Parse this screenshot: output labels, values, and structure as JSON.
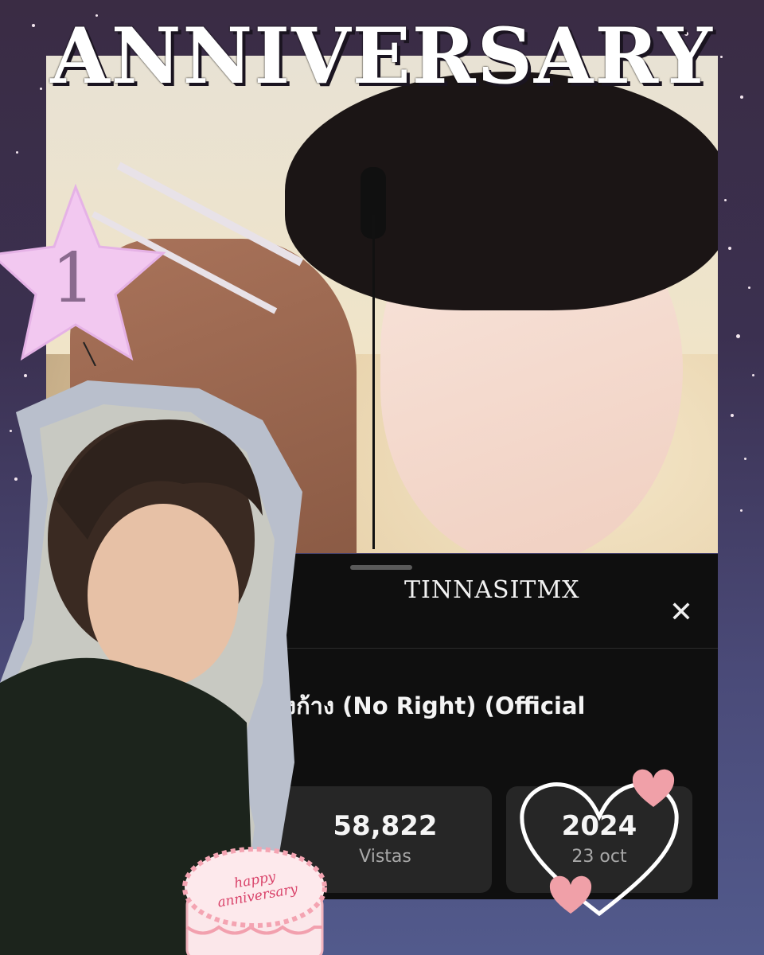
{
  "banner": {
    "title": "ANNIVERSARY"
  },
  "badge": {
    "number": "1"
  },
  "card": {
    "channel": "TINNASITMX",
    "close_icon": "close-icon",
    "video_title": "หมาหวงก้าง (No Right) (Official",
    "stats": [
      {
        "value": "58,822",
        "label": "Vistas"
      },
      {
        "value": "2024",
        "label": "23 oct"
      }
    ]
  },
  "cake": {
    "line1": "happy",
    "line2": "anniversary"
  },
  "colors": {
    "background": "#3b3050",
    "card": "#0f0f0f",
    "stat_box": "#262626",
    "star": "#f2c8f0",
    "heart": "#f0a0a8"
  }
}
